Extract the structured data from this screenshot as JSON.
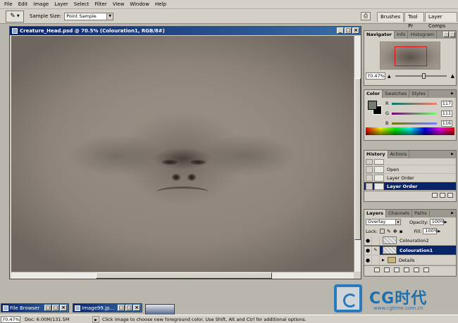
{
  "menu": [
    "File",
    "Edit",
    "Image",
    "Layer",
    "Select",
    "Filter",
    "View",
    "Window",
    "Help"
  ],
  "options": {
    "tool_icon": "eyedropper-icon",
    "sample_size_label": "Sample Size:",
    "sample_size_value": "Point Sample"
  },
  "palette_well": [
    "Brushes",
    "Tool Pr",
    "Layer Comps"
  ],
  "document": {
    "title": "Creature_Head.psd @ 70.5% (Colouration1, RGB/8#)"
  },
  "navigator": {
    "tabs": [
      "Navigator",
      "Info",
      "Histogram"
    ],
    "zoom": "70.47%"
  },
  "color": {
    "tabs": [
      "Color",
      "Swatches",
      "Styles"
    ],
    "foreground": "#757b6f",
    "background": "#000000",
    "r_label": "R",
    "r": "117",
    "g_label": "G",
    "g": "111",
    "b_label": "B",
    "b": "116"
  },
  "history": {
    "tabs": [
      "History",
      "Actions"
    ],
    "items": [
      "Open",
      "Layer Order",
      "Layer Order"
    ]
  },
  "layers": {
    "tabs": [
      "Layers",
      "Channels",
      "Paths"
    ],
    "blend_mode": "Overlay",
    "opacity_label": "Opacity:",
    "opacity": "100%",
    "lock_label": "Lock:",
    "fill_label": "Fill:",
    "fill": "100%",
    "items": [
      "Colouration2",
      "Colouration1",
      "Details"
    ]
  },
  "minimized": {
    "file_browser": "File Browser",
    "image99": "Image99.jp..."
  },
  "status": {
    "zoom": "70.47%",
    "doc": "Doc: 6.00M/131.5M",
    "message": "Click image to choose new foreground color. Use Shift, Alt and Ctrl for additional options."
  },
  "watermark": {
    "brand": "CG时代",
    "url": "www.cgtime.com.cn"
  }
}
